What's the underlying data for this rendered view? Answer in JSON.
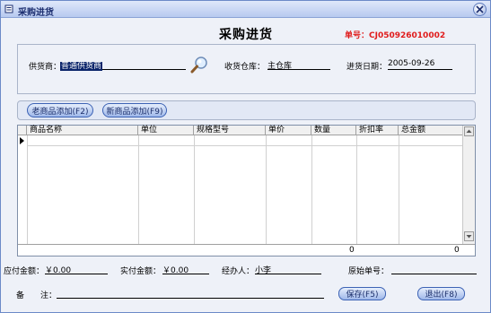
{
  "window": {
    "title": "采购进货"
  },
  "form": {
    "title": "采购进货",
    "order_no": "单号：CJ050926010002"
  },
  "header": {
    "supplier_label": "供货商：",
    "supplier_value": "普通供货商",
    "warehouse_label": "收货仓库：",
    "warehouse_value": "主仓库",
    "date_label": "进货日期：",
    "date_value": "2005-09-26"
  },
  "buttons": {
    "add_old": "老商品添加(F2)",
    "add_new": "新商品添加(F9)",
    "save": "保存(F5)",
    "exit": "退出(F8)"
  },
  "grid": {
    "columns": [
      "商品名称",
      "单位",
      "规格型号",
      "单价",
      "数量",
      "折扣率",
      "总金额"
    ],
    "totals": {
      "quantity": "0",
      "amount": "0"
    }
  },
  "footer": {
    "payable_label": "应付金额：",
    "payable_value": "￥0.00",
    "paid_label": "实付金额：",
    "paid_value": "￥0.00",
    "handler_label": "经办人：",
    "handler_value": "小李",
    "orig_no_label": "原始单号：",
    "orig_no_value": "",
    "remark_label": "备　　注：",
    "remark_value": ""
  }
}
